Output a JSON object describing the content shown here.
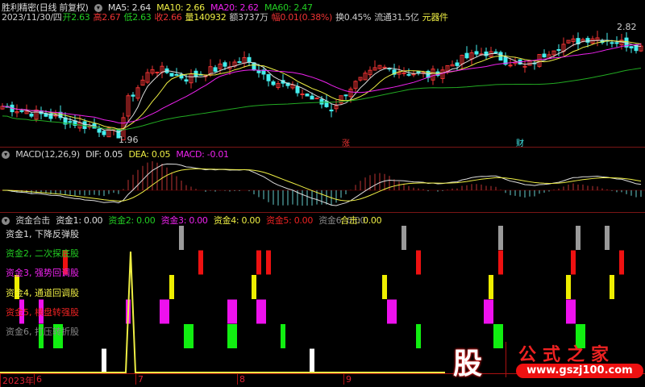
{
  "header": {
    "title": "胜利精密(日线 前复权)",
    "ma5": "MA5: 2.64",
    "ma10": "MA10: 2.66",
    "ma20": "MA20: 2.62",
    "ma60": "MA60: 2.47",
    "date": "2023/11/30/四",
    "open_l": "开",
    "open": "2.63",
    "high_l": "高",
    "high": "2.67",
    "low_l": "低",
    "low": "2.63",
    "close_l": "收",
    "close": "2.66",
    "vol_l": "量",
    "vol": "140932",
    "amt": "额3737万",
    "chg_l": "幅",
    "chg": "0.01(0.38%)",
    "turnover": "换0.45%",
    "float": "流通31.5亿",
    "sector": "元器件"
  },
  "price": {
    "high_mark": "2.82",
    "low_mark": "1.96",
    "max": 2.82,
    "min": 1.96,
    "anchors": [
      [
        0,
        2.2
      ],
      [
        10,
        2.12
      ],
      [
        24,
        1.98
      ],
      [
        26,
        2.25
      ],
      [
        31,
        2.5
      ],
      [
        38,
        2.42
      ],
      [
        50,
        2.56
      ],
      [
        56,
        2.4
      ],
      [
        62,
        2.3
      ],
      [
        68,
        2.18
      ],
      [
        72,
        2.35
      ],
      [
        78,
        2.5
      ],
      [
        88,
        2.44
      ],
      [
        96,
        2.58
      ],
      [
        100,
        2.62
      ],
      [
        108,
        2.5
      ],
      [
        114,
        2.66
      ],
      [
        122,
        2.74
      ],
      [
        125,
        2.72
      ],
      [
        132,
        2.66
      ]
    ],
    "events": [
      {
        "label": "涨",
        "bar": 71
      },
      {
        "label": "财",
        "bar": 107
      }
    ]
  },
  "macd": {
    "title": "MACD(12,26,9)",
    "dif": "DIF: 0.05",
    "dea": "DEA: 0.05",
    "macd": "MACD: -0.01"
  },
  "fund": {
    "title": "资金合击",
    "f1": "资金1: 0.00",
    "f2": "资金2: 0.00",
    "f3": "资金3: 0.00",
    "f4": "资金4: 0.00",
    "f5": "资金5: 0.00",
    "f6": "资金6: 0.00",
    "total": "合击: 0.00",
    "legend": [
      "资金1, 下降反弹股",
      "资金2, 二次探底股",
      "资金3, 强势回调股",
      "资金4, 通道回调股",
      "资金5, 横盘转强股",
      "资金6, 打压转折股"
    ],
    "rows": [
      {
        "color": "#9a9a9a",
        "bars": [
          37,
          83,
          103,
          119,
          125
        ]
      },
      {
        "color": "#ee1111",
        "bars": [
          13,
          41,
          53,
          55,
          86,
          103,
          118,
          128
        ]
      },
      {
        "color": "#eeee00",
        "bars": [
          3,
          35,
          52,
          79,
          101,
          117,
          126
        ]
      },
      {
        "color": "#ee11ee",
        "bars": [
          4,
          8,
          26,
          33,
          34,
          47,
          48,
          53,
          54,
          80,
          81,
          100,
          101,
          117,
          118
        ]
      },
      {
        "color": "#11ee11",
        "bars": [
          8,
          11,
          12,
          38,
          39,
          47,
          48,
          58,
          86,
          102,
          103,
          119,
          120
        ]
      },
      {
        "color": "#ffffff",
        "bars": [
          21,
          64
        ]
      }
    ],
    "spike_bar": 27
  },
  "axis": {
    "dates": [
      {
        "label": "2023年",
        "bar": 0
      },
      {
        "label": "6",
        "bar": 7
      },
      {
        "label": "7",
        "bar": 28
      },
      {
        "label": "8",
        "bar": 49
      },
      {
        "label": "9",
        "bar": 71
      }
    ]
  },
  "logo": {
    "mark": "股",
    "name": "公式之家",
    "url": "www.gszj100.com"
  }
}
